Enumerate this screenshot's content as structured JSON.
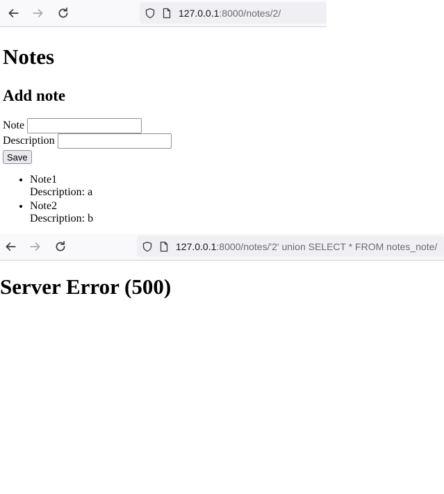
{
  "browser_top": {
    "url_host": "127.0.0.1",
    "url_path": ":8000/notes/2/"
  },
  "browser_bottom": {
    "url_host": "127.0.0.1",
    "url_path": ":8000/notes/'2' union SELECT * FROM notes_note/"
  },
  "page": {
    "title": "Notes",
    "subtitle": "Add note",
    "form": {
      "note_label": "Note",
      "note_value": "",
      "description_label": "Description",
      "description_value": "",
      "save_label": "Save"
    },
    "notes": [
      {
        "title": "Note1",
        "description": "Description: a"
      },
      {
        "title": "Note2",
        "description": "Description: b"
      }
    ]
  },
  "error_page": {
    "title": "Server Error (500)"
  },
  "icons": [
    "back-arrow-icon",
    "forward-arrow-icon",
    "reload-icon",
    "shield-icon",
    "page-icon"
  ]
}
